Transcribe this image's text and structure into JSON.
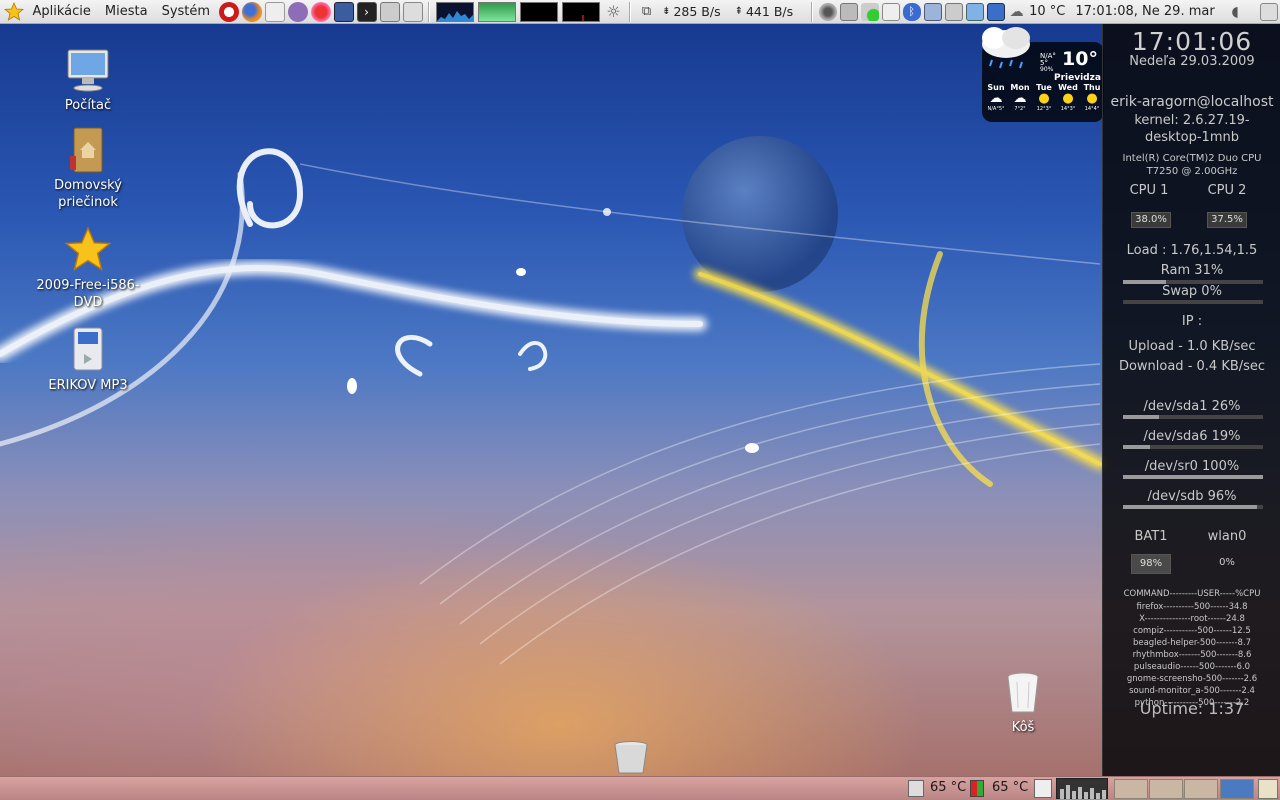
{
  "top_panel": {
    "menus": [
      "Aplikácie",
      "Miesta",
      "Systém"
    ],
    "net_up": "285 B/s",
    "net_down": "441 B/s",
    "temperature": "10 °C",
    "clock": "17:01:08, Ne 29. mar"
  },
  "desktop_icons": [
    {
      "label": "Počítač"
    },
    {
      "label": "Domovský priečinok"
    },
    {
      "label": "2009-Free-i586-DVD"
    },
    {
      "label": "ERIKOV MP3"
    },
    {
      "label": "Kôš"
    }
  ],
  "weather": {
    "temp": "10°",
    "city": "Prievidza",
    "na_1": "N/A°",
    "na_2": "5°",
    "na_3": "90%",
    "days": [
      {
        "name": "Sun",
        "temps": "N/A°5°"
      },
      {
        "name": "Mon",
        "temps": "7°2°"
      },
      {
        "name": "Tue",
        "temps": "12°3°"
      },
      {
        "name": "Wed",
        "temps": "14°3°"
      },
      {
        "name": "Thu",
        "temps": "14°4°"
      }
    ]
  },
  "conky": {
    "time": "17:01:06",
    "date": "Nedeľa 29.03.2009",
    "host": "erik-aragorn@localhost",
    "kernel_1": "kernel: 2.6.27.19-",
    "kernel_2": "desktop-1mnb",
    "cpu_1": "Intel(R) Core(TM)2 Duo CPU",
    "cpu_2": "T7250  @ 2.00GHz",
    "cpu1_label": "CPU 1",
    "cpu2_label": "CPU 2",
    "cpu1_value": "38.0%",
    "cpu2_value": "37.5%",
    "load": "Load : 1.76,1.54,1.5",
    "ram": "Ram 31%",
    "ram_fraction": 0.31,
    "swap": "Swap 0%",
    "swap_fraction": 0.0,
    "ip": "IP :",
    "upload": "Upload - 1.0 KB/sec",
    "download": "Download - 0.4 KB/sec",
    "disks": [
      {
        "label": "/dev/sda1 26%",
        "fraction": 0.26
      },
      {
        "label": "/dev/sda6 19%",
        "fraction": 0.19
      },
      {
        "label": "/dev/sr0 100%",
        "fraction": 1.0
      },
      {
        "label": "/dev/sdb 96%",
        "fraction": 0.96
      }
    ],
    "bat_label": "BAT1",
    "bat_value": "98%",
    "wlan_label": "wlan0",
    "wlan_value": "0%",
    "proc_header": "COMMAND---------USER-----%CPU",
    "processes": [
      "firefox----------500------34.8",
      "X---------------root------24.8",
      "compiz-----------500------12.5",
      "beagled-helper-500-------8.7",
      "rhythmbox-------500-------8.6",
      "pulseaudio------500-------6.0",
      "gnome-screensho-500-------2.6",
      "sound-monitor_a-500-------2.4",
      "python-----------500-------2.2"
    ],
    "uptime": "Uptime: 1:37"
  },
  "bottom_panel": {
    "temp1": "65 °C",
    "temp2": "65 °C"
  },
  "colors": {
    "panel_top": "#e6e6e6",
    "panel_bottom": "#c99594",
    "conky_bg": "#0a0a0e",
    "conky_text": "#c9c9c9"
  }
}
